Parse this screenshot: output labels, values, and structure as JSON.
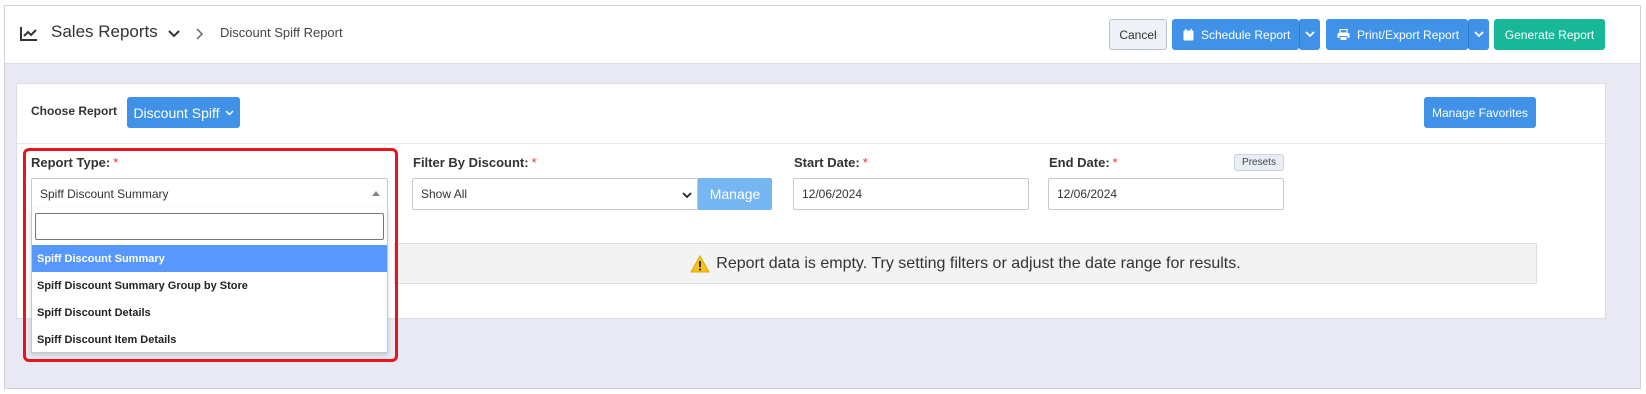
{
  "header": {
    "title": "Sales Reports",
    "breadcrumb": "Discount Spiff Report",
    "cancel_label": "Cancel",
    "schedule_label": "Schedule Report",
    "print_label": "Print/Export Report",
    "generate_label": "Generate Report"
  },
  "toolbar": {
    "choose_label": "Choose Report",
    "report_button": "Discount Spiff",
    "favorites_label": "Manage Favorites"
  },
  "filters": {
    "report_type_label": "Report Type:",
    "report_type_value": "Spiff Discount Summary",
    "discount_label": "Filter By Discount:",
    "discount_value": "Show All",
    "manage_label": "Manage",
    "start_label": "Start Date:",
    "start_value": "12/06/2024",
    "end_label": "End Date:",
    "end_value": "12/06/2024",
    "presets_label": "Presets",
    "required_mark": "*"
  },
  "dropdown": {
    "search_value": "",
    "options": [
      "Spiff Discount Summary",
      "Spiff Discount Summary Group by Store",
      "Spiff Discount Details",
      "Spiff Discount Item Details"
    ],
    "selected_index": 0
  },
  "alert": {
    "message": "Report data is empty. Try setting filters or adjust the date range for results."
  },
  "colors": {
    "primary": "#3f92e8",
    "success": "#17b897",
    "highlight": "#e8141c",
    "selected_option": "#5897fb"
  },
  "icons": {
    "header": "chart-line-icon",
    "schedule": "calendar-icon",
    "print": "printer-icon",
    "alert": "warning-icon"
  }
}
